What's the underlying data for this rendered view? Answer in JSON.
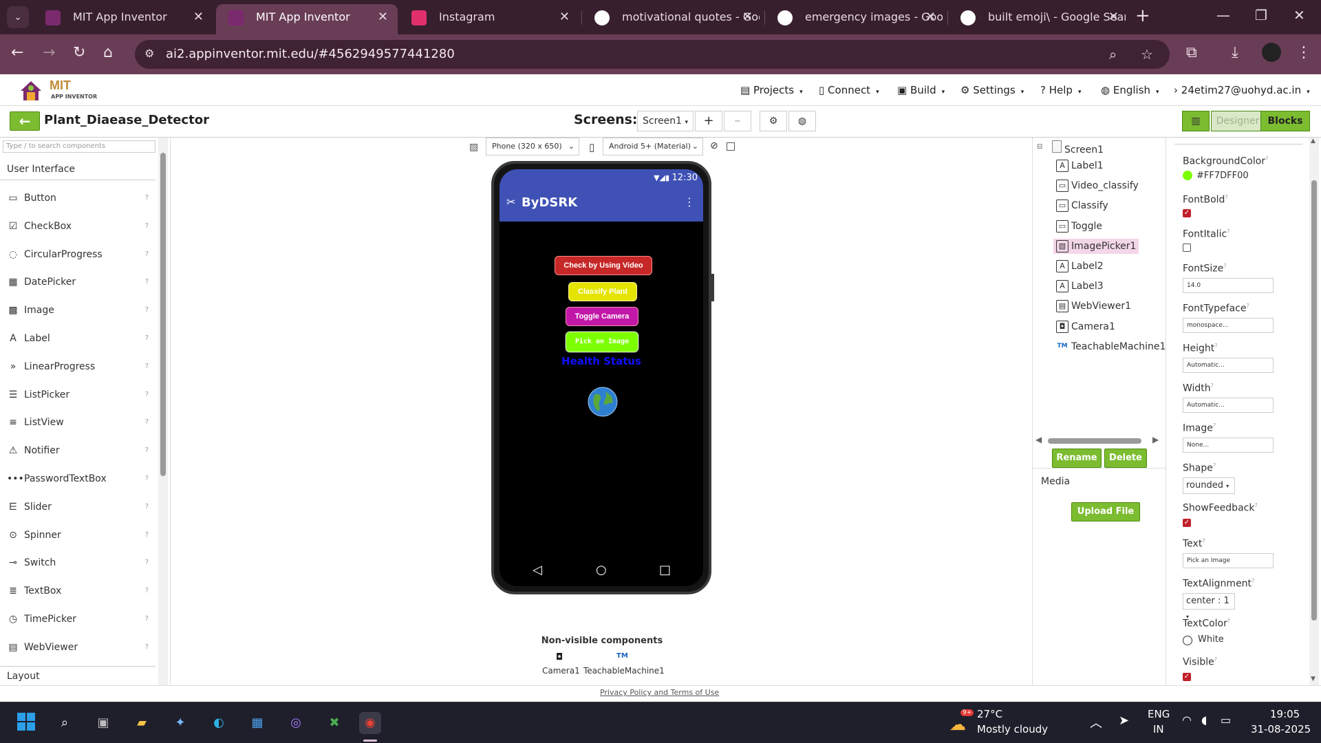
{
  "browser": {
    "tabs": [
      {
        "label": "MIT App Inventor"
      },
      {
        "label": "MIT App Inventor"
      },
      {
        "label": "Instagram"
      },
      {
        "label": "motivational quotes - Goog"
      },
      {
        "label": "emergency images - Goog"
      },
      {
        "label": "built emoji\\ - Google Searc"
      }
    ],
    "url": "ai2.appinventor.mit.edu/#4562949577441280"
  },
  "app": {
    "logo_main": "MIT",
    "logo_sub": "APP INVENTOR",
    "menu": {
      "projects": "Projects",
      "connect": "Connect",
      "build": "Build",
      "settings": "Settings",
      "help": "Help",
      "language": "English",
      "account": "24etim27@uohyd.ac.in"
    },
    "project_name": "Plant_Diaease_Detector",
    "screens_label": "Screens:",
    "screen_select": "Screen1",
    "designer_btn": "Designer",
    "blocks_btn": "Blocks"
  },
  "palette": {
    "search_placeholder": "Type / to search components",
    "category": "User Interface",
    "items": [
      {
        "label": "Button",
        "icon": "button-icon"
      },
      {
        "label": "CheckBox",
        "icon": "checkbox-icon"
      },
      {
        "label": "CircularProgress",
        "icon": "circular-progress-icon"
      },
      {
        "label": "DatePicker",
        "icon": "calendar-icon"
      },
      {
        "label": "Image",
        "icon": "image-icon"
      },
      {
        "label": "Label",
        "icon": "label-icon"
      },
      {
        "label": "LinearProgress",
        "icon": "linear-progress-icon"
      },
      {
        "label": "ListPicker",
        "icon": "list-picker-icon"
      },
      {
        "label": "ListView",
        "icon": "list-view-icon"
      },
      {
        "label": "Notifier",
        "icon": "warning-icon"
      },
      {
        "label": "PasswordTextBox",
        "icon": "password-icon"
      },
      {
        "label": "Slider",
        "icon": "slider-icon"
      },
      {
        "label": "Spinner",
        "icon": "spinner-icon"
      },
      {
        "label": "Switch",
        "icon": "switch-icon"
      },
      {
        "label": "TextBox",
        "icon": "textbox-icon"
      },
      {
        "label": "TimePicker",
        "icon": "clock-icon"
      },
      {
        "label": "WebViewer",
        "icon": "webviewer-icon"
      }
    ],
    "next_category": "Layout"
  },
  "viewer": {
    "device_select": "Phone (320 x 650)",
    "theme_select": "Android 5+ (Material)",
    "phone": {
      "time": "12:30",
      "title": "ByDSRK",
      "buttons": {
        "video": "Check by Using Video",
        "classify": "Classify Plant",
        "toggle": "Toggle Camera",
        "pick": "Pick an Image"
      },
      "health_status": "Health Status"
    },
    "nonvisible_title": "Non-visible components",
    "nonvisible": [
      "Camera1",
      "TeachableMachine1"
    ]
  },
  "components": {
    "root": "Screen1",
    "items": [
      {
        "label": "Label1",
        "icon": "label-icon"
      },
      {
        "label": "Video_classify",
        "icon": "button-icon"
      },
      {
        "label": "Classify",
        "icon": "button-icon"
      },
      {
        "label": "Toggle",
        "icon": "button-icon"
      },
      {
        "label": "ImagePicker1",
        "icon": "image-picker-icon"
      },
      {
        "label": "Label2",
        "icon": "label-icon"
      },
      {
        "label": "Label3",
        "icon": "label-icon"
      },
      {
        "label": "WebViewer1",
        "icon": "webviewer-icon"
      },
      {
        "label": "Camera1",
        "icon": "camera-icon"
      },
      {
        "label": "TeachableMachine1",
        "icon": "teachable-machine-icon"
      }
    ],
    "rename": "Rename",
    "delete": "Delete",
    "media_title": "Media",
    "upload": "Upload File ..."
  },
  "properties": {
    "bg_color_label": "BackgroundColor",
    "bg_color_value": "#FF7DFF00",
    "font_bold_label": "FontBold",
    "font_bold": true,
    "font_italic_label": "FontItalic",
    "font_italic": false,
    "font_size_label": "FontSize",
    "font_size": "14.0",
    "font_typeface_label": "FontTypeface",
    "font_typeface": "monospace...",
    "height_label": "Height",
    "height": "Automatic...",
    "width_label": "Width",
    "width": "Automatic...",
    "image_label": "Image",
    "image": "None...",
    "shape_label": "Shape",
    "shape": "rounded",
    "show_feedback_label": "ShowFeedback",
    "show_feedback": true,
    "text_label": "Text",
    "text": "Pick an Image",
    "text_alignment_label": "TextAlignment",
    "text_alignment": "center : 1",
    "text_color_label": "TextColor",
    "text_color": "White",
    "visible_label": "Visible",
    "visible": true
  },
  "footer": {
    "privacy": "Privacy Policy and Terms of Use"
  },
  "taskbar": {
    "weather_temp": "27°C",
    "weather_desc": "Mostly cloudy",
    "weather_badge": "9+",
    "lang": "ENG",
    "region": "IN",
    "time": "19:05",
    "date": "31-08-2025"
  },
  "colors": {
    "accent_green": "#7cbc31",
    "phone_bar": "#3f51b5",
    "btn_video": "#c62828",
    "btn_classify": "#e4e400",
    "btn_toggle": "#c218a8",
    "btn_pick": "#7dff00",
    "health_text": "#1010ff"
  }
}
